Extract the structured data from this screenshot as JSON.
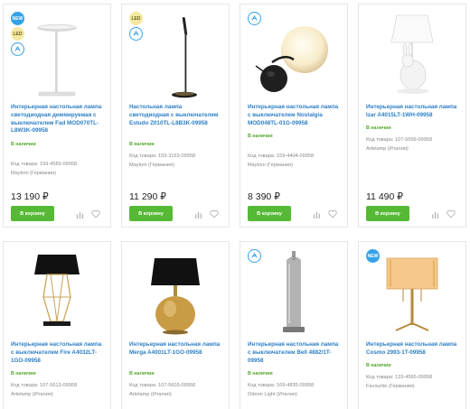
{
  "badge_new": "NEW",
  "badge_led": "LED",
  "colors": {
    "link": "#2c7fc5",
    "stock": "#54a82b",
    "button": "#56b935",
    "badge_new": "#35a2e8"
  },
  "products": [
    {
      "title": "Интерьерная настольная лампа светодиодная диммируемая с выключателем Fad MOD070TL-L8W3K-09958",
      "stock": "В наличии",
      "code": "Код товара: 159-4583-09958",
      "brand": "Maytoni (Германия)",
      "price": "13 190 ₽",
      "button": "В корзину",
      "badges": [
        "new",
        "led",
        "dimmable-icon"
      ]
    },
    {
      "title": "Настольная лампа светодиодная с выключателем Estudo Z010TL-L8B3K-09958",
      "stock": "В наличии",
      "code": "Код товара: 159-3163-09958",
      "brand": "Maytoni (Германия)",
      "price": "11 290 ₽",
      "button": "В корзину",
      "badges": [
        "led",
        "dimmable-icon"
      ]
    },
    {
      "title": "Интерьерная настольная лампа с выключателем Nostalgia MOD048TL-01G-09958",
      "stock": "В наличии",
      "code": "Код товара: 159-4404-09958",
      "brand": "Maytoni (Германия)",
      "price": "8 390 ₽",
      "button": "В корзину",
      "badges": [
        "dimmable-icon"
      ]
    },
    {
      "title": "Интерьерная настольная лампа Izar A4015LT-1WH-09958",
      "stock": "В наличии",
      "code": "Код товара: 107-5599-09958",
      "brand": "Artelamp (Италия)",
      "price": "11 490 ₽",
      "button": "В корзину",
      "badges": []
    },
    {
      "title": "Интерьерная настольная лампа с выключателем Fire A4032LT-1GO-09958",
      "stock": "В наличии",
      "code": "Код товара: 107-5613-09958",
      "brand": "Artelamp (Италия)",
      "badges": []
    },
    {
      "title": "Интерьерная настольная лампа Merga A4001LT-1GO-09958",
      "stock": "В наличии",
      "code": "Код товара: 107-5603-09958",
      "brand": "Artelamp (Италия)",
      "badges": []
    },
    {
      "title": "Интерьерная настольная лампа с выключателем Bell 4882/1T-09958",
      "stock": "В наличии",
      "code": "Код товара: 169-4835-09958",
      "brand": "Odeon Light (Италия)",
      "badges": [
        "dimmable-icon"
      ]
    },
    {
      "title": "Интерьерная настольная лампа Cosmo 2993-1T-09958",
      "stock": "В наличии",
      "code": "Код товара: 133-4565-09958",
      "brand": "Favourite (Германия)",
      "badges": [
        "new"
      ]
    }
  ]
}
